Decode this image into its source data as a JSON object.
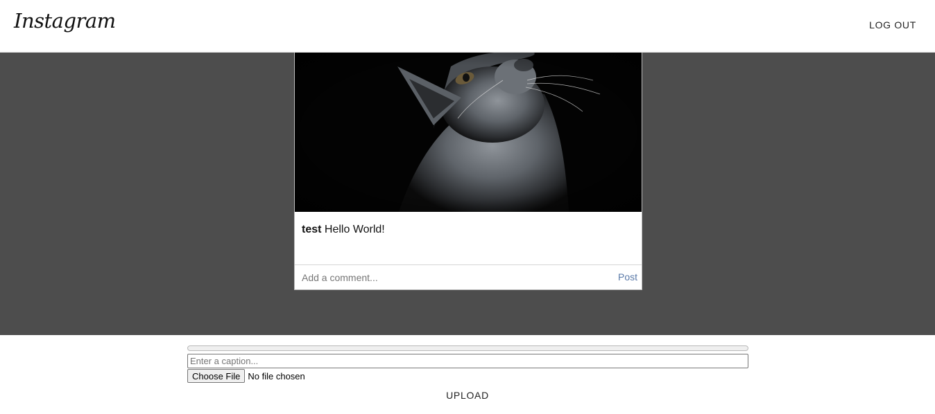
{
  "header": {
    "logo_text": "Instagram",
    "logout_label": "LOG OUT"
  },
  "post": {
    "username": "test",
    "caption": "Hello World!",
    "comment_placeholder": "Add a comment...",
    "post_label": "Post"
  },
  "upload": {
    "progress": 0,
    "caption_placeholder": "Enter a caption...",
    "choose_file_label": "Choose File",
    "file_status": "No file chosen",
    "upload_label": "UPLOAD"
  },
  "colors": {
    "feed_background": "#4d4d4d",
    "post_link": "#5a79a8"
  }
}
